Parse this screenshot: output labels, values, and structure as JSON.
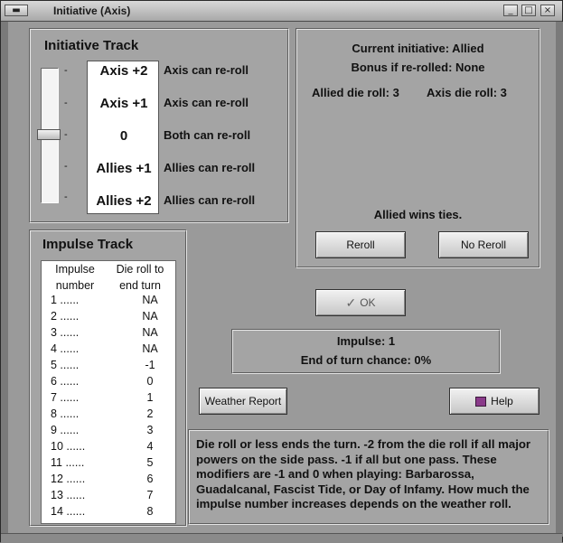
{
  "window": {
    "title": "Initiative (Axis)"
  },
  "initiative_track": {
    "heading": "Initiative Track",
    "ticks": [
      "-",
      "-",
      "-",
      "-",
      "-"
    ],
    "rows": [
      {
        "value": "Axis +2",
        "desc": "Axis can re-roll"
      },
      {
        "value": "Axis +1",
        "desc": "Axis can re-roll"
      },
      {
        "value": "0",
        "desc": "Both can re-roll"
      },
      {
        "value": "Allies +1",
        "desc": "Allies can re-roll"
      },
      {
        "value": "Allies +2",
        "desc": "Allies can re-roll"
      }
    ],
    "slider_position": "0"
  },
  "status": {
    "current_initiative": "Current initiative: Allied",
    "bonus": "Bonus if re-rolled: None",
    "allied_roll": "Allied die roll: 3",
    "axis_roll": "Axis die roll: 3",
    "ties": "Allied wins ties.",
    "reroll_label": "Reroll",
    "no_reroll_label": "No Reroll"
  },
  "ok_label": "OK",
  "impulse_info": {
    "impulse": "Impulse: 1",
    "chance": "End of turn chance: 0%"
  },
  "weather_label": "Weather Report",
  "help_label": "Help",
  "impulse_track": {
    "heading": "Impulse Track",
    "col1_line1": "Impulse",
    "col1_line2": "number",
    "col2_line1": "Die roll to",
    "col2_line2": "end turn",
    "rows": [
      {
        "num": "1 ......",
        "val": "NA"
      },
      {
        "num": "2 ......",
        "val": "NA"
      },
      {
        "num": "3 ......",
        "val": "NA"
      },
      {
        "num": "4 ......",
        "val": "NA"
      },
      {
        "num": "5 ......",
        "val": "-1"
      },
      {
        "num": "6 ......",
        "val": "0"
      },
      {
        "num": "7 ......",
        "val": "1"
      },
      {
        "num": "8 ......",
        "val": "2"
      },
      {
        "num": "9 ......",
        "val": "3"
      },
      {
        "num": "10 ......",
        "val": "4"
      },
      {
        "num": "11 ......",
        "val": "5"
      },
      {
        "num": "12 ......",
        "val": "6"
      },
      {
        "num": "13 ......",
        "val": "7"
      },
      {
        "num": "14 ......",
        "val": "8"
      }
    ]
  },
  "help_text": "Die roll or less ends the turn.  -2 from the die roll if all major powers on the side pass.  -1 if all but one pass.  These modifiers are -1 and 0 when playing: Barbarossa, Guadalcanal, Fascist Tide, or Day of Infamy.  How much the impulse number increases depends on the weather roll."
}
